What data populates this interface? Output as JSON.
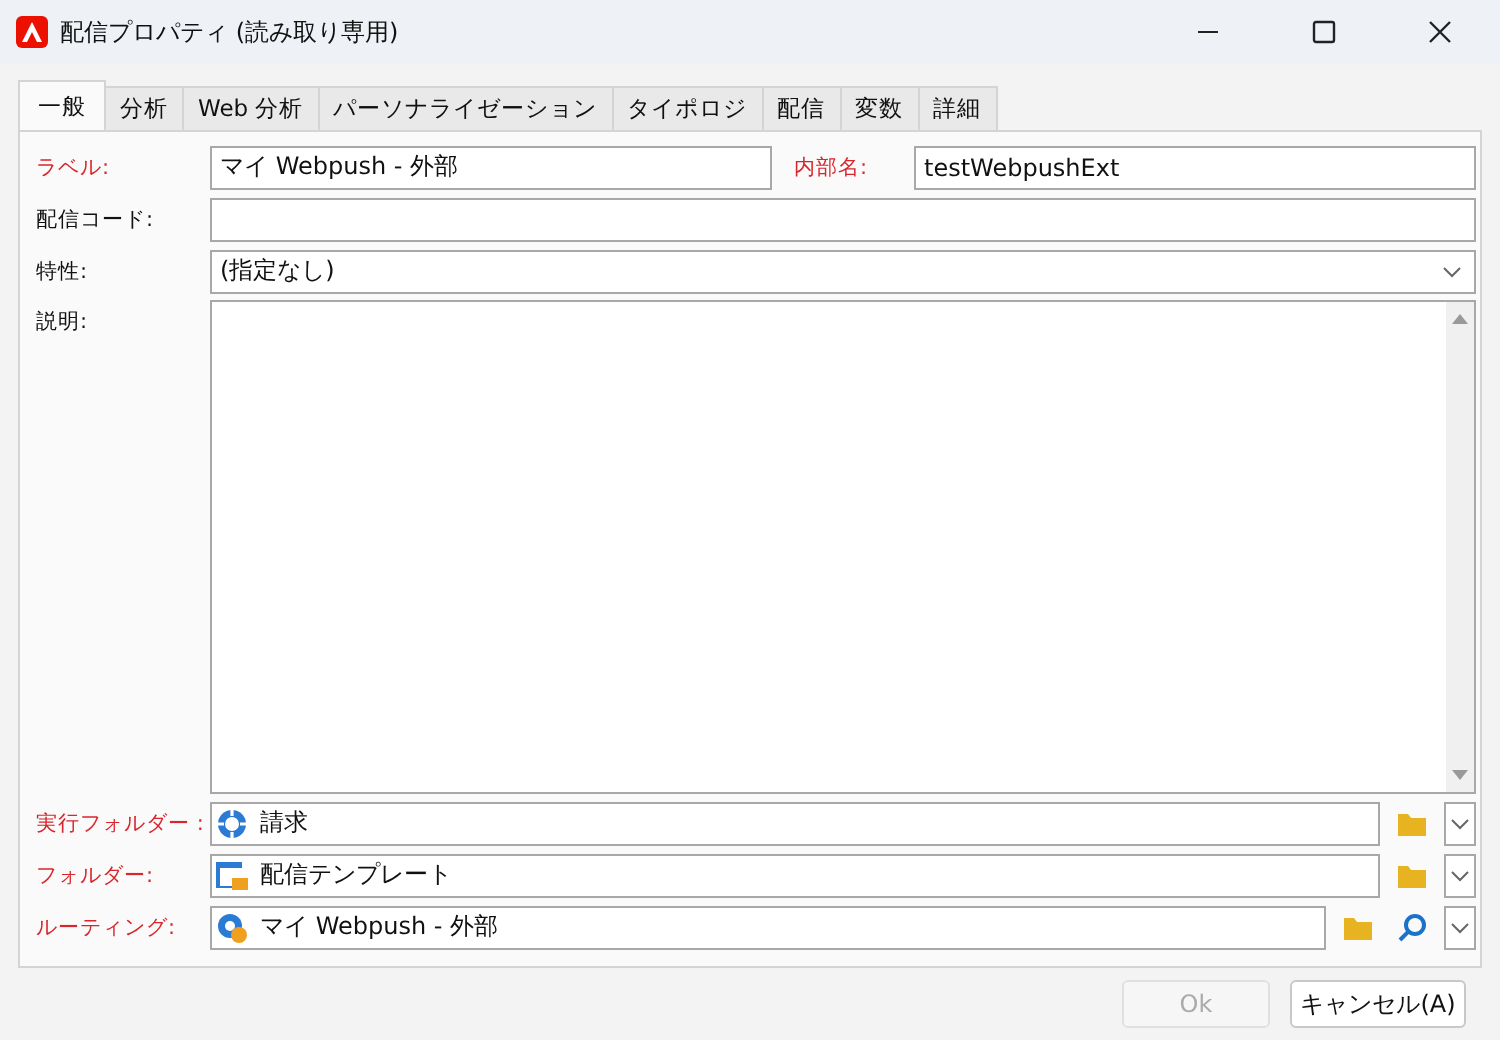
{
  "window": {
    "title": "配信プロパティ (読み取り専用)"
  },
  "tabs": [
    {
      "label": "一般",
      "selected": true
    },
    {
      "label": "分析",
      "selected": false
    },
    {
      "label": "Web 分析",
      "selected": false
    },
    {
      "label": "パーソナライゼーション",
      "selected": false
    },
    {
      "label": "タイポロジ",
      "selected": false
    },
    {
      "label": "配信",
      "selected": false
    },
    {
      "label": "変数",
      "selected": false
    },
    {
      "label": "詳細",
      "selected": false
    }
  ],
  "fields": [
    {
      "kind": "pair",
      "label": "ラベル:",
      "required": true,
      "value": "マイ Webpush - 外部",
      "label2": "内部名:",
      "required2": true,
      "value2": "testWebpushExt"
    },
    {
      "kind": "text",
      "label": "配信コード:",
      "required": false
    },
    {
      "kind": "dropdown",
      "label": "特性:",
      "required": false,
      "value": "(指定なし)"
    },
    {
      "kind": "textarea",
      "label": "説明:",
      "required": false
    },
    {
      "kind": "picker",
      "label": "実行フォルダー :",
      "required": true,
      "value": "請求",
      "search": false
    },
    {
      "kind": "picker",
      "label": "フォルダー:",
      "required": true,
      "value": "配信テンプレート",
      "search": false
    },
    {
      "kind": "picker",
      "label": "ルーティング:",
      "required": true,
      "value": "マイ Webpush - 外部",
      "search": true
    }
  ],
  "buttons": [
    {
      "label": "Ok",
      "disabled": true
    },
    {
      "label": "キャンセル(A)",
      "disabled": false
    }
  ]
}
